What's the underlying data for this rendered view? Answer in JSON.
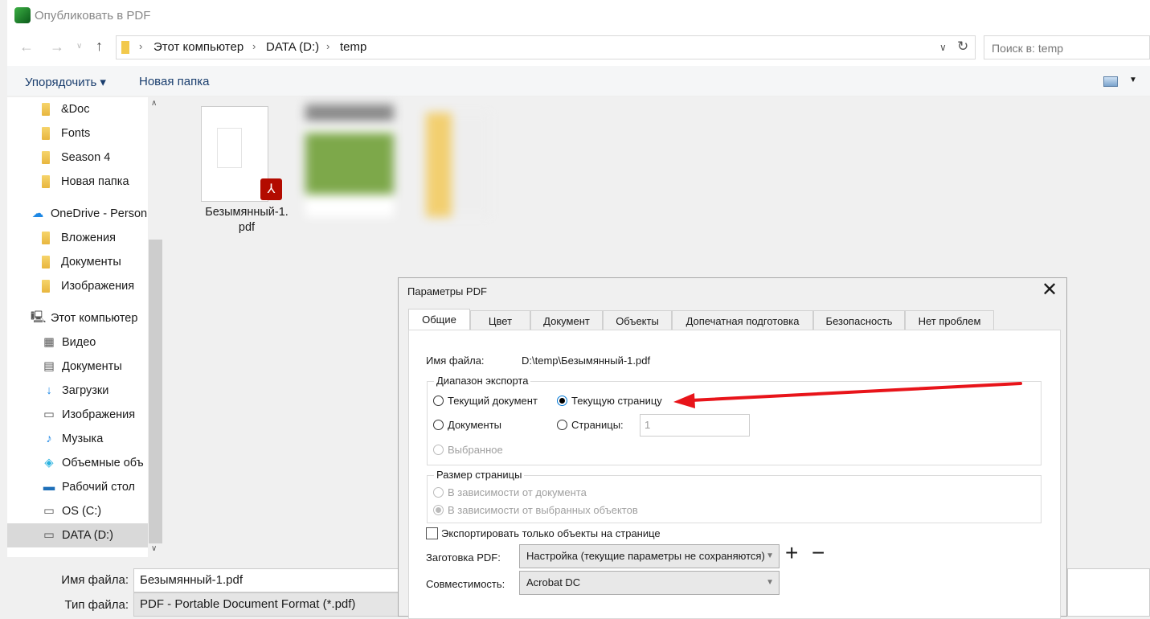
{
  "window": {
    "title": "Опубликовать в PDF"
  },
  "nav": {
    "breadcrumbs": [
      "Этот компьютер",
      "DATA (D:)",
      "temp"
    ],
    "search_placeholder": "Поиск в: temp"
  },
  "toolbar": {
    "organize": "Упорядочить",
    "new_folder": "Новая папка"
  },
  "sidebar": {
    "items": [
      {
        "label": "&Doc",
        "icon": "folder-icon"
      },
      {
        "label": "Fonts",
        "icon": "folder-icon"
      },
      {
        "label": "Season 4",
        "icon": "folder-icon"
      },
      {
        "label": "Новая папка",
        "icon": "folder-icon"
      },
      {
        "label": "OneDrive - Person",
        "icon": "cloud-icon"
      },
      {
        "label": "Вложения",
        "icon": "folder-icon"
      },
      {
        "label": "Документы",
        "icon": "folder-icon"
      },
      {
        "label": "Изображения",
        "icon": "folder-icon"
      },
      {
        "label": "Этот компьютер",
        "icon": "computer-icon"
      },
      {
        "label": "Видео",
        "icon": "video-icon"
      },
      {
        "label": "Документы",
        "icon": "document-icon"
      },
      {
        "label": "Загрузки",
        "icon": "download-icon"
      },
      {
        "label": "Изображения",
        "icon": "image-icon"
      },
      {
        "label": "Музыка",
        "icon": "music-icon"
      },
      {
        "label": "Объемные объ",
        "icon": "cube-icon"
      },
      {
        "label": "Рабочий стол",
        "icon": "desktop-icon"
      },
      {
        "label": "OS (C:)",
        "icon": "drive-icon"
      },
      {
        "label": "DATA (D:)",
        "icon": "drive-icon",
        "selected": true
      }
    ]
  },
  "files": [
    {
      "name": "Безымянный-1.pdf",
      "line1": "Безымянный-1.",
      "line2": "pdf"
    }
  ],
  "bottom": {
    "filename_label": "Имя файла:",
    "filename_value": "Безымянный-1.pdf",
    "filetype_label": "Тип файла:",
    "filetype_value": "PDF - Portable Document Format (*.pdf)"
  },
  "dialog": {
    "title": "Параметры PDF",
    "tabs": [
      "Общие",
      "Цвет",
      "Документ",
      "Объекты",
      "Допечатная подготовка",
      "Безопасность",
      "Нет проблем"
    ],
    "filename_label": "Имя файла:",
    "filename_value": "D:\\temp\\Безымянный-1.pdf",
    "export_range": {
      "title": "Диапазон экспорта",
      "current_doc": "Текущий документ",
      "current_page": "Текущую страницу",
      "documents": "Документы",
      "pages": "Страницы:",
      "pages_value": "1",
      "selection": "Выбранное",
      "selected": "current_page"
    },
    "page_size": {
      "title": "Размер страницы",
      "by_document": "В зависимости от документа",
      "by_selection": "В зависимости от выбранных объектов",
      "selected": "by_selection"
    },
    "export_only_objects": {
      "label": "Экспортировать только объекты на странице",
      "checked": false
    },
    "preset": {
      "label": "Заготовка PDF:",
      "value": "Настройка (текущие параметры не сохраняются)"
    },
    "compat": {
      "label": "Совместимость:",
      "value": "Acrobat DC"
    }
  },
  "colors": {
    "arrow": "#e8141a",
    "pdf_badge": "#b30b00"
  }
}
